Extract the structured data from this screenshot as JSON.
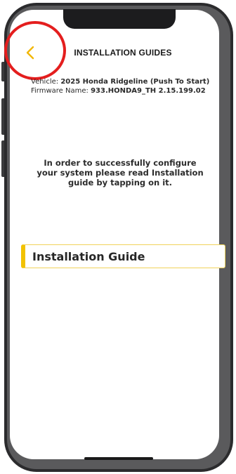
{
  "header": {
    "title": "INSTALLATION GUIDES",
    "back_icon": "chevron-left-icon",
    "accent_color": "#f2b705",
    "highlight_color": "#e41e1e"
  },
  "vehicle_info": {
    "vehicle_label": "Vehicle:",
    "vehicle_value": "2025 Honda Ridgeline (Push To Start)",
    "firmware_label": "Firmware Name:",
    "firmware_value": "933.HONDA9_TH 2.15.199.02"
  },
  "instruction": {
    "text": "In order to successfully configure your system please read Installation guide by tapping on it."
  },
  "guides": [
    {
      "label": "Installation Guide",
      "accent_color": "#f2c200"
    }
  ]
}
